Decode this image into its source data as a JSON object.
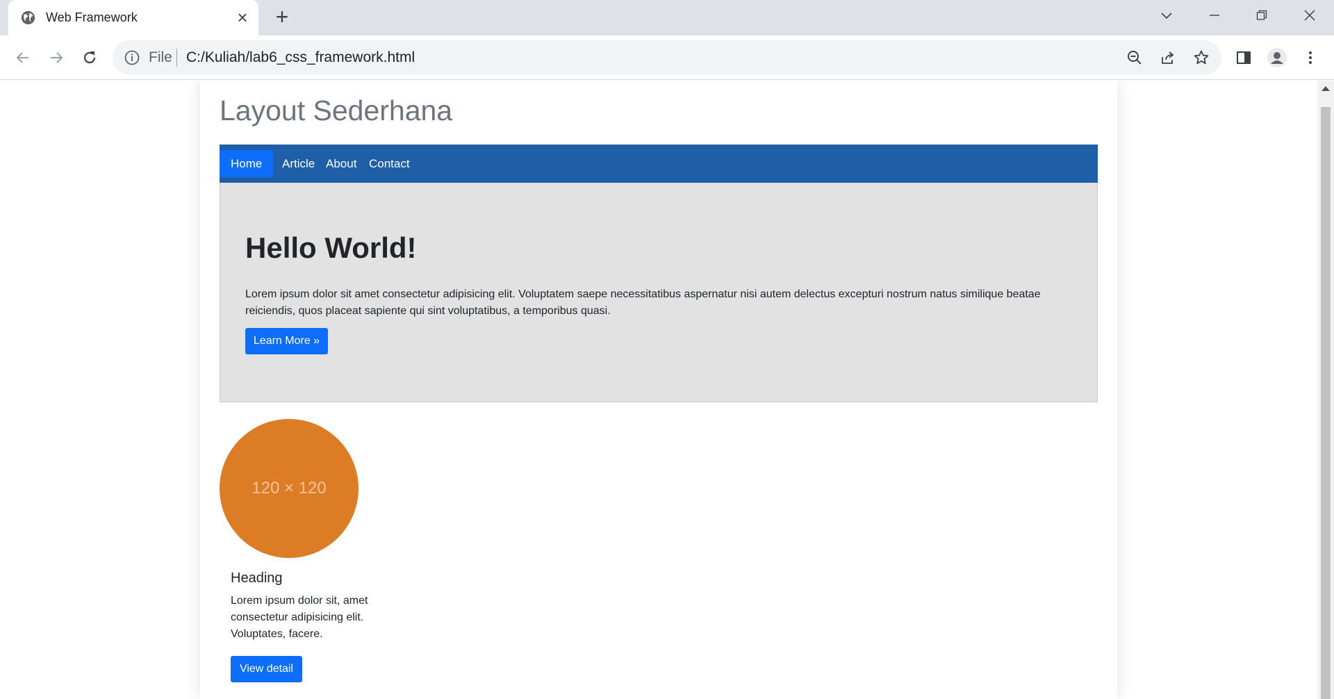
{
  "browser": {
    "tab_title": "Web Framework",
    "new_tab": "+",
    "close_tab": "×",
    "address_scheme": "File",
    "address_url": "C:/Kuliah/lab6_css_framework.html"
  },
  "page": {
    "site_title": "Layout Sederhana",
    "nav": {
      "home": "Home",
      "article": "Article",
      "about": "About",
      "contact": "Contact"
    },
    "jumbotron": {
      "title": "Hello World!",
      "text": "Lorem ipsum dolor sit amet consectetur adipisicing elit. Voluptatem saepe necessitatibus aspernatur nisi autem delectus excepturi nostrum natus similique beatae reiciendis, quos placeat sapiente qui sint voluptatibus, a temporibus quasi.",
      "button": "Learn More »"
    },
    "card": {
      "image_placeholder": "120 × 120",
      "heading": "Heading",
      "text": "Lorem ipsum dolor sit, amet consectetur adipisicing elit. Voluptates, facere.",
      "button": "View detail"
    }
  },
  "colors": {
    "navbar": "#1f5fa8",
    "primary_button": "#0d6efd",
    "jumbotron_bg": "#e2e2e3",
    "placeholder_circle": "#dc7c25"
  }
}
